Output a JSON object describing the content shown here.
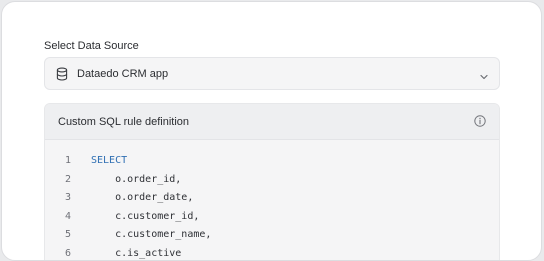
{
  "form": {
    "label": "Select Data Source",
    "selected_value": "Dataedo CRM app",
    "icon": "database-icon",
    "chevron_icon": "chevron-down-icon"
  },
  "sql_editor": {
    "title": "Custom SQL rule definition",
    "info_icon": "info-icon",
    "keyword_color": "#2f6fb3",
    "lines": [
      {
        "number": "1",
        "text": "SELECT",
        "keyword": true
      },
      {
        "number": "2",
        "text": "    o.order_id,",
        "keyword": false
      },
      {
        "number": "3",
        "text": "    o.order_date,",
        "keyword": false
      },
      {
        "number": "4",
        "text": "    c.customer_id,",
        "keyword": false
      },
      {
        "number": "5",
        "text": "    c.customer_name,",
        "keyword": false
      },
      {
        "number": "6",
        "text": "    c.is_active",
        "keyword": false
      }
    ]
  }
}
